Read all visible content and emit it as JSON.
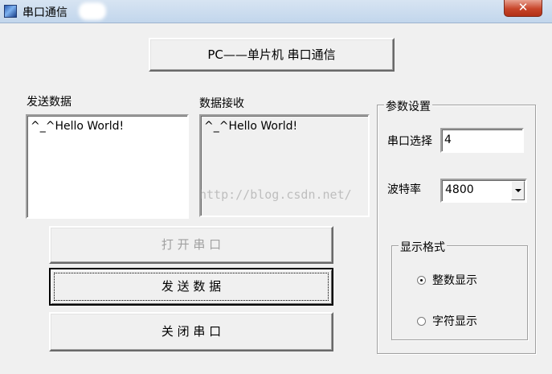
{
  "window": {
    "title": "串口通信",
    "close_symbol": "✕"
  },
  "header_button": {
    "label": "PC——单片机  串口通信"
  },
  "send": {
    "label": "发送数据",
    "text": "^_^Hello World!"
  },
  "receive": {
    "label": "数据接收",
    "text": "^_^Hello World!"
  },
  "buttons": {
    "open_port": "打 开 串 口",
    "send_data": "发 送 数 据",
    "close_port": "关 闭 串 口"
  },
  "params": {
    "group_label": "参数设置",
    "port_label": "串口选择",
    "port_value": "4",
    "baud_label": "波特率",
    "baud_value": "4800"
  },
  "display_format": {
    "group_label": "显示格式",
    "option_integer": "整数显示",
    "option_char": "字符显示",
    "selected": "整数显示"
  },
  "watermark": "http://blog.csdn.net/"
}
